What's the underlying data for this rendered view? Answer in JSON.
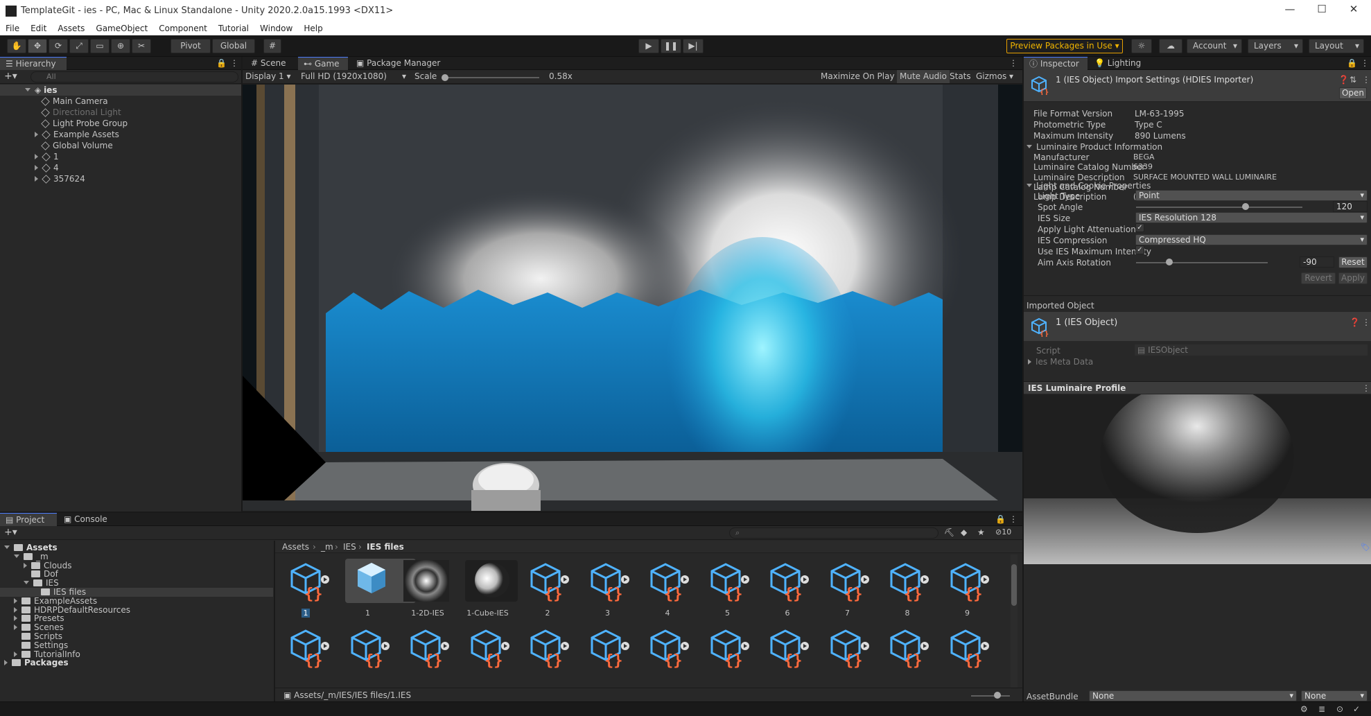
{
  "window": {
    "title": "TemplateGit - ies - PC, Mac & Linux Standalone - Unity 2020.2.0a15.1993 <DX11>"
  },
  "menu": [
    "File",
    "Edit",
    "Assets",
    "GameObject",
    "Component",
    "Tutorial",
    "Window",
    "Help"
  ],
  "toolbar": {
    "pivot": "Pivot",
    "global": "Global",
    "preview_packages": "Preview Packages in Use",
    "account": "Account",
    "layers": "Layers",
    "layout": "Layout"
  },
  "hierarchy": {
    "tab": "Hierarchy",
    "search_placeholder": "All",
    "scene": "ies",
    "items": [
      {
        "label": "Main Camera",
        "dim": false,
        "expandable": false
      },
      {
        "label": "Directional Light",
        "dim": true,
        "expandable": false
      },
      {
        "label": "Light Probe Group",
        "dim": false,
        "expandable": false
      },
      {
        "label": "Example Assets",
        "dim": false,
        "expandable": true
      },
      {
        "label": "Global Volume",
        "dim": false,
        "expandable": false
      },
      {
        "label": "1",
        "dim": false,
        "expandable": true
      },
      {
        "label": "4",
        "dim": false,
        "expandable": true
      },
      {
        "label": "357624",
        "dim": false,
        "expandable": true
      }
    ]
  },
  "game": {
    "tabs": [
      "Scene",
      "Game",
      "Package Manager"
    ],
    "display": "Display 1",
    "resolution": "Full HD (1920x1080)",
    "scale_label": "Scale",
    "scale_value": "0.58x",
    "options": [
      "Maximize On Play",
      "Mute Audio",
      "Stats",
      "Gizmos"
    ]
  },
  "inspector": {
    "tabs": [
      "Inspector",
      "Lighting"
    ],
    "header": "1 (IES Object) Import Settings (HDIES Importer)",
    "open": "Open",
    "fields": [
      {
        "label": "File Format Version",
        "value": "LM-63-1995"
      },
      {
        "label": "Photometric Type",
        "value": "Type C"
      },
      {
        "label": "Maximum Intensity",
        "value": "890 Lumens"
      }
    ],
    "luminaire_section": "Luminaire Product Information",
    "luminaire": [
      {
        "label": "Manufacturer",
        "value": "BEGA"
      },
      {
        "label": "Luminaire Catalog Number",
        "value": "6339"
      },
      {
        "label": "Luminaire Description",
        "value": "SURFACE MOUNTED WALL LUMINAIRE"
      },
      {
        "label": "Lamp Catalog Number",
        "value": ""
      },
      {
        "label": "Lamp Description",
        "value": "(1) 60W A-19 INC"
      }
    ],
    "light_section": "Light and Cookie Properties",
    "light_type": {
      "label": "Light Type",
      "value": "Point"
    },
    "spot_angle": {
      "label": "Spot Angle",
      "value": "120",
      "fraction": 0.66
    },
    "ies_size": {
      "label": "IES Size",
      "value": "IES Resolution 128"
    },
    "apply_atten": {
      "label": "Apply Light Attenuation",
      "checked": "✓"
    },
    "ies_compression": {
      "label": "IES Compression",
      "value": "Compressed HQ"
    },
    "use_max": {
      "label": "Use IES Maximum Intensity",
      "checked": "✓"
    },
    "aim_axis": {
      "label": "Aim Axis Rotation",
      "value": "-90",
      "fraction": 0.25,
      "reset": "Reset"
    },
    "revert": "Revert",
    "apply": "Apply",
    "imported_object": "Imported Object",
    "imported_name": "1 (IES Object)",
    "script_label": "Script",
    "script_value": "IESObject",
    "meta": "Ies Meta Data",
    "profile": "IES Luminaire Profile",
    "assetbundle": "AssetBundle",
    "ab_none1": "None",
    "ab_none2": "None"
  },
  "project": {
    "tabs": [
      "Project",
      "Console"
    ],
    "hidden_count": "10",
    "tree": [
      {
        "label": "Assets",
        "indent": 0,
        "bold": true,
        "open": true
      },
      {
        "label": "_m",
        "indent": 1,
        "open": true
      },
      {
        "label": "Clouds",
        "indent": 2,
        "exp": true
      },
      {
        "label": "Dof",
        "indent": 2
      },
      {
        "label": "IES",
        "indent": 2,
        "open": true
      },
      {
        "label": "IES files",
        "indent": 3,
        "sel": true
      },
      {
        "label": "ExampleAssets",
        "indent": 1,
        "exp": true
      },
      {
        "label": "HDRPDefaultResources",
        "indent": 1,
        "exp": true
      },
      {
        "label": "Presets",
        "indent": 1,
        "exp": true
      },
      {
        "label": "Scenes",
        "indent": 1,
        "exp": true
      },
      {
        "label": "Scripts",
        "indent": 1
      },
      {
        "label": "Settings",
        "indent": 1
      },
      {
        "label": "TutorialInfo",
        "indent": 1,
        "exp": true
      },
      {
        "label": "Packages",
        "indent": 0,
        "bold": true,
        "exp": true
      }
    ],
    "breadcrumb": [
      "Assets",
      "_m",
      "IES",
      "IES files"
    ],
    "assets": [
      "1",
      "1",
      "1-2D-IES",
      "1-Cube-IES",
      "2",
      "3",
      "4",
      "5",
      "6",
      "7",
      "8",
      "9"
    ],
    "status_path": "Assets/_m/IES/IES files/1.IES"
  },
  "colors": {
    "accent": "#4c7dff",
    "ies_cube": "#4fb3ff",
    "ies_brace": "#ff6a3d"
  }
}
